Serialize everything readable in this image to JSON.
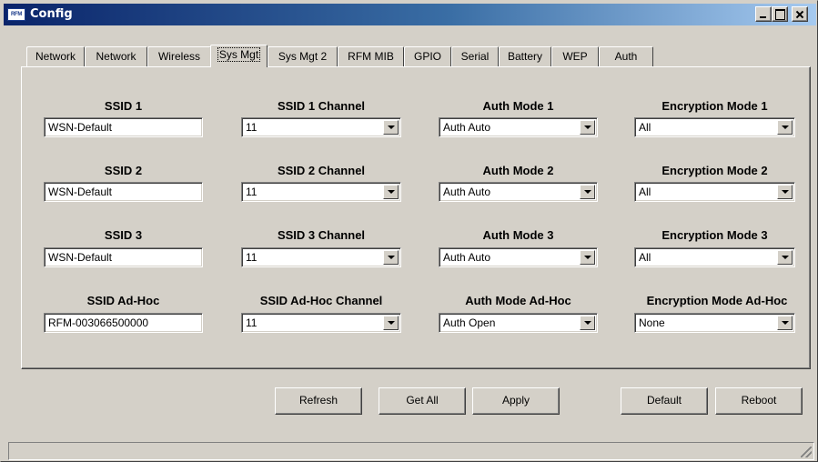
{
  "window": {
    "title": "Config",
    "app_icon_text": "RFM"
  },
  "tabs": [
    {
      "label": "Network",
      "active": false
    },
    {
      "label": "Network",
      "active": false
    },
    {
      "label": "Wireless",
      "active": false
    },
    {
      "label": "Sys Mgt",
      "active": true
    },
    {
      "label": "Sys Mgt 2",
      "active": false
    },
    {
      "label": "RFM MIB",
      "active": false
    },
    {
      "label": "GPIO",
      "active": false
    },
    {
      "label": "Serial",
      "active": false
    },
    {
      "label": "Battery",
      "active": false
    },
    {
      "label": "WEP",
      "active": false
    },
    {
      "label": "Auth",
      "active": false
    }
  ],
  "rows": [
    {
      "ssid_label": "SSID 1",
      "ssid_value": "WSN-Default",
      "channel_label": "SSID 1 Channel",
      "channel_value": "11",
      "auth_label": "Auth Mode 1",
      "auth_value": "Auth Auto",
      "enc_label": "Encryption Mode 1",
      "enc_value": "All"
    },
    {
      "ssid_label": "SSID 2",
      "ssid_value": "WSN-Default",
      "channel_label": "SSID 2 Channel",
      "channel_value": "11",
      "auth_label": "Auth Mode 2",
      "auth_value": "Auth Auto",
      "enc_label": "Encryption Mode 2",
      "enc_value": "All"
    },
    {
      "ssid_label": "SSID 3",
      "ssid_value": "WSN-Default",
      "channel_label": "SSID 3 Channel",
      "channel_value": "11",
      "auth_label": "Auth Mode 3",
      "auth_value": "Auth Auto",
      "enc_label": "Encryption Mode 3",
      "enc_value": "All"
    },
    {
      "ssid_label": "SSID Ad-Hoc",
      "ssid_value": "RFM-003066500000",
      "channel_label": "SSID Ad-Hoc Channel",
      "channel_value": "11",
      "auth_label": "Auth Mode Ad-Hoc",
      "auth_value": "Auth Open",
      "enc_label": "Encryption Mode Ad-Hoc",
      "enc_value": "None"
    }
  ],
  "buttons": {
    "refresh": "Refresh",
    "get_all": "Get All",
    "apply": "Apply",
    "default": "Default",
    "reboot": "Reboot"
  },
  "colors": {
    "window_face": "#d4d0c8",
    "title_gradient_start": "#0a246a",
    "title_gradient_end": "#a6caf0"
  }
}
